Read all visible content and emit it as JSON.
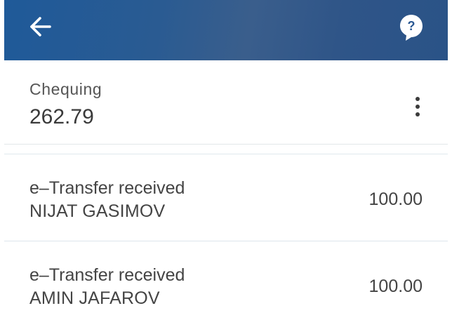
{
  "header": {
    "back_icon": "arrow-left-icon",
    "help_icon": "help-chat-bubble-icon",
    "help_glyph": "?",
    "background_color": "#2a5892"
  },
  "account": {
    "name": "Chequing",
    "balance": "262.79",
    "menu_icon": "more-vertical-icon"
  },
  "transactions": [
    {
      "title": "e–Transfer received",
      "counterparty": "NIJAT GASIMOV",
      "amount": "100.00"
    },
    {
      "title": "e–Transfer received",
      "counterparty": "AMIN JAFAROV",
      "amount": "100.00"
    }
  ]
}
